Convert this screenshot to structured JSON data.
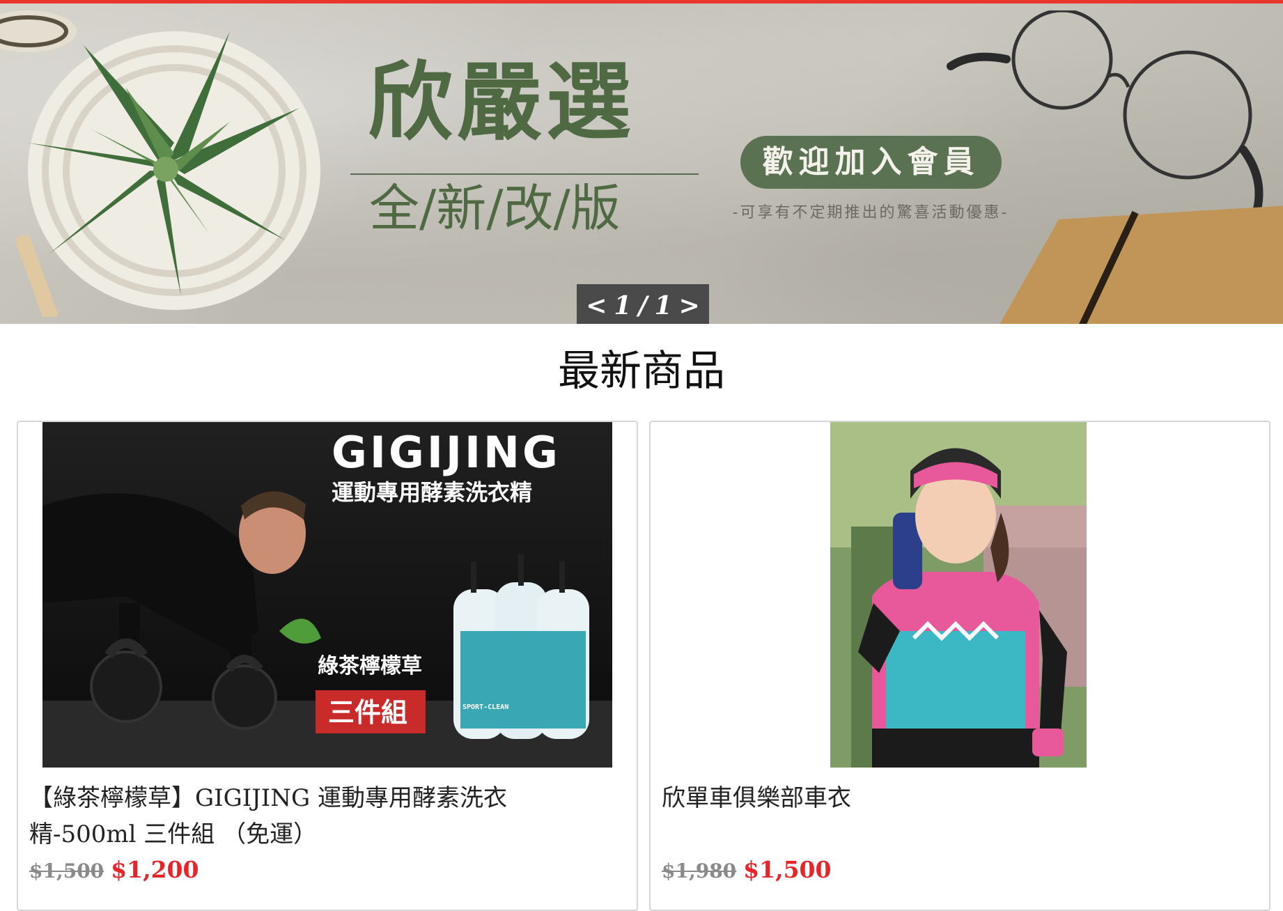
{
  "colors": {
    "accent": "#e8362b",
    "price": "#e8242b",
    "banner_green": "#4f6a43"
  },
  "banner": {
    "title": "欣嚴選",
    "subtitle": "全/新/改/版",
    "pill": "歡迎加入會員",
    "note": "-可享有不定期推出的驚喜活動優惠-",
    "pager": {
      "prev": "<",
      "current": "1",
      "sep": "/",
      "total": "1",
      "next": ">"
    }
  },
  "section": {
    "title": "最新商品"
  },
  "products": [
    {
      "image_text": {
        "brand": "GIGIJING",
        "headline": "運動專用酵素洗衣精",
        "flavor": "綠茶檸檬草",
        "set": "三件組",
        "bottle_label": "SPORT-CLEAN"
      },
      "name": "【綠茶檸檬草】GIGIJING 運動專用酵素洗衣精-500ml 三件組 （免運）",
      "old_price": "$1,500",
      "price": "$1,200"
    },
    {
      "name": "欣單車俱樂部車衣",
      "old_price": "$1,980",
      "price": "$1,500"
    }
  ]
}
